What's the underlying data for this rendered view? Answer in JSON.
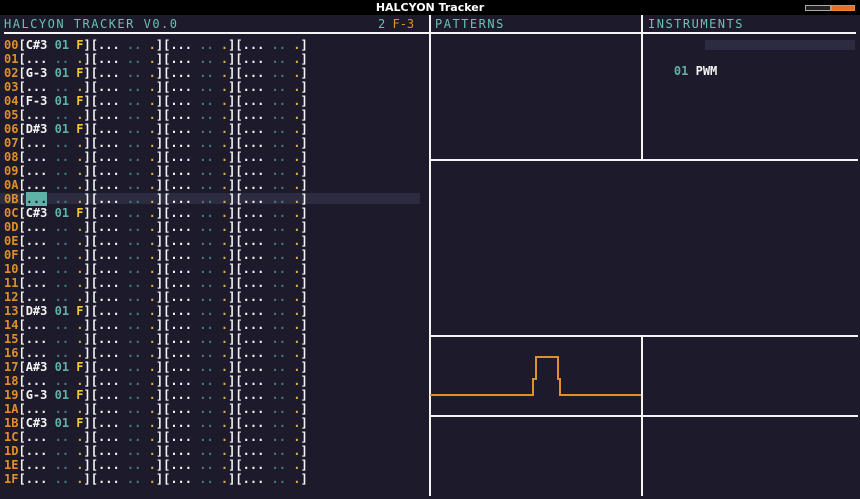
{
  "window": {
    "title": "HALCYON Tracker"
  },
  "header": {
    "app_title": "HALCYON TRACKER V0.0",
    "octave": "2",
    "current_note": "F-3",
    "patterns_label": "PATTERNS",
    "instruments_label": "INSTRUMENTS"
  },
  "instruments": [
    {
      "number": "01",
      "name": "PWM"
    }
  ],
  "sequencer": {
    "cursor_row": "0B",
    "empty_cell": {
      "note": "...",
      "instrument": "..",
      "effect": "."
    },
    "rows": [
      {
        "num": "00",
        "note": "C#3",
        "instrument": "01",
        "effect": "F"
      },
      {
        "num": "01"
      },
      {
        "num": "02",
        "note": "G-3",
        "instrument": "01",
        "effect": "F"
      },
      {
        "num": "03"
      },
      {
        "num": "04",
        "note": "F-3",
        "instrument": "01",
        "effect": "F"
      },
      {
        "num": "05"
      },
      {
        "num": "06",
        "note": "D#3",
        "instrument": "01",
        "effect": "F"
      },
      {
        "num": "07"
      },
      {
        "num": "08"
      },
      {
        "num": "09"
      },
      {
        "num": "0A"
      },
      {
        "num": "0B"
      },
      {
        "num": "0C",
        "note": "C#3",
        "instrument": "01",
        "effect": "F"
      },
      {
        "num": "0D"
      },
      {
        "num": "0E"
      },
      {
        "num": "0F"
      },
      {
        "num": "10"
      },
      {
        "num": "11"
      },
      {
        "num": "12"
      },
      {
        "num": "13",
        "note": "D#3",
        "instrument": "01",
        "effect": "F"
      },
      {
        "num": "14"
      },
      {
        "num": "15"
      },
      {
        "num": "16"
      },
      {
        "num": "17",
        "note": "A#3",
        "instrument": "01",
        "effect": "F"
      },
      {
        "num": "18"
      },
      {
        "num": "19",
        "note": "G-3",
        "instrument": "01",
        "effect": "F"
      },
      {
        "num": "1A"
      },
      {
        "num": "1B",
        "note": "C#3",
        "instrument": "01",
        "effect": "F"
      },
      {
        "num": "1C"
      },
      {
        "num": "1D"
      },
      {
        "num": "1E"
      },
      {
        "num": "1F"
      }
    ]
  },
  "colors": {
    "background": "#1d1b2b",
    "row_number": "#e0902a",
    "note": "#f4f4f4",
    "instrument": "#5fb2a8",
    "effect": "#f0c830",
    "waveform": "#e0902a",
    "cursor": "#5fb2a8"
  }
}
